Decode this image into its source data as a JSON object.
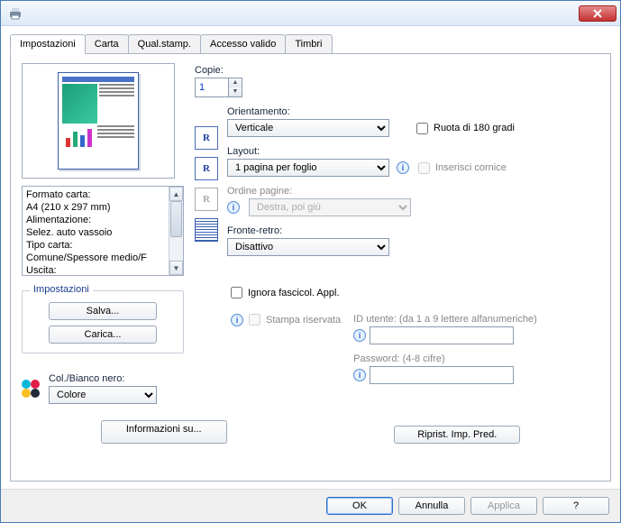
{
  "tabs": [
    "Impostazioni",
    "Carta",
    "Qual.stamp.",
    "Accesso valido",
    "Timbri"
  ],
  "active_tab": 0,
  "specs": {
    "l1": "Formato carta:",
    "l2": "  A4 (210 x 297 mm)",
    "l3": "Alimentazione:",
    "l4": "  Selez. auto vassoio",
    "l5": "Tipo carta:",
    "l6": "  Comune/Spessore medio/F",
    "l7": "Uscita:"
  },
  "group": {
    "title": "Impostazioni",
    "save": "Salva...",
    "load": "Carica..."
  },
  "color": {
    "label": "Col./Bianco nero:",
    "value": "Colore"
  },
  "copies": {
    "label": "Copie:",
    "value": "1"
  },
  "orientation": {
    "label": "Orientamento:",
    "value": "Verticale",
    "rotate": "Ruota di 180 gradi"
  },
  "layout": {
    "label": "Layout:",
    "value": "1 pagina per foglio",
    "frame": "Inserisci cornice"
  },
  "page_order": {
    "label": "Ordine pagine:",
    "value": "Destra, poi giù"
  },
  "duplex": {
    "label": "Fronte-retro:",
    "value": "Disattivo"
  },
  "ignore_collate": "Ignora fascicol. Appl.",
  "secure": {
    "label": "Stampa riservata"
  },
  "userid": {
    "label": "ID utente: (da 1 a 9 lettere alfanumeriche)"
  },
  "password": {
    "label": "Password: (4-8 cifre)"
  },
  "info_btn": "Informazioni su...",
  "reset_btn": "Riprist. Imp. Pred.",
  "dlg": {
    "ok": "OK",
    "cancel": "Annulla",
    "apply": "Applica",
    "help": "?"
  }
}
